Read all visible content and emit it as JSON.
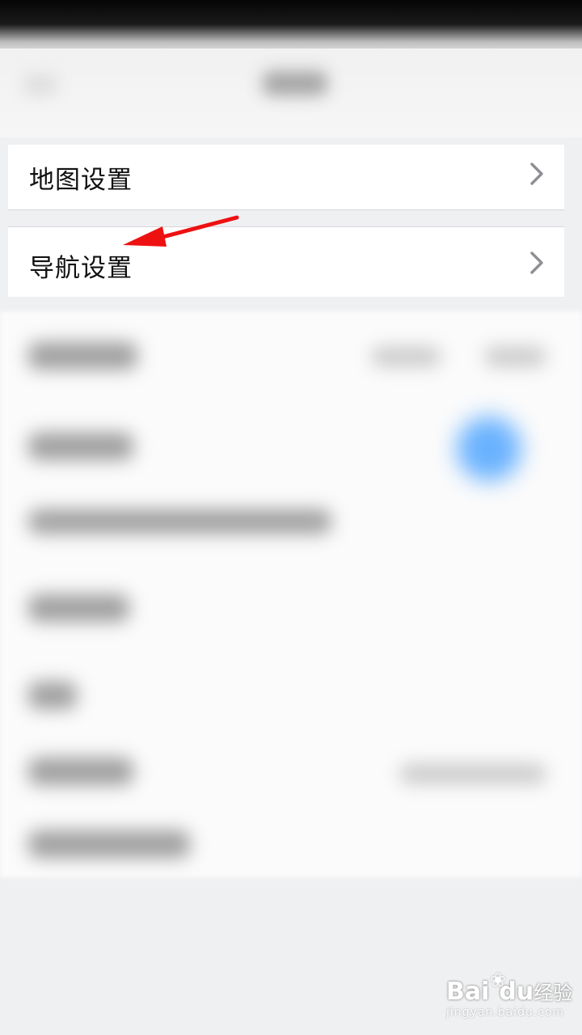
{
  "settings": {
    "map_settings_label": "地图设置",
    "navigation_settings_label": "导航设置"
  },
  "icons": {
    "chevron": "chevron-right-icon",
    "annotation": "red-arrow"
  },
  "colors": {
    "annotation_arrow": "#ee1111",
    "chevron": "#8e8e93",
    "toggle_blurred": "#5aaaff",
    "background": "#eff0f2"
  },
  "watermark": {
    "logo_a": "Bai",
    "logo_b": "du",
    "logo_cn": "经验",
    "sub": "jingyan.baidu.com"
  }
}
